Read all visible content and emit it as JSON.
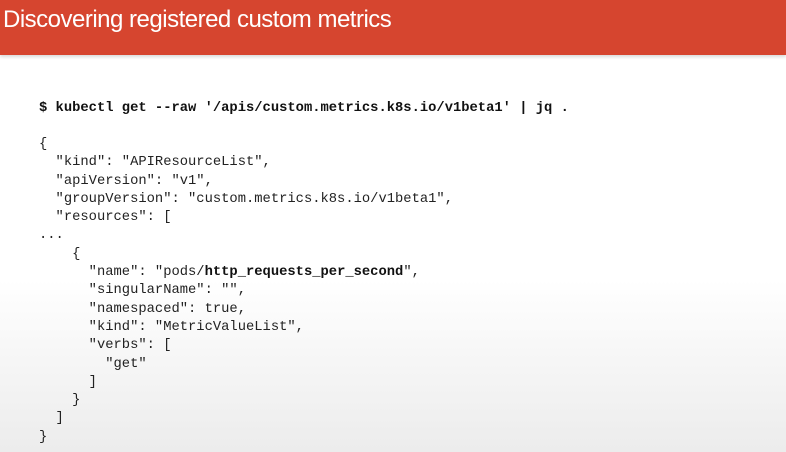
{
  "slide": {
    "title": "Discovering registered custom metrics",
    "command": "$ kubectl get --raw '/apis/custom.metrics.k8s.io/v1beta1' | jq .",
    "colors": {
      "header": "#d6452f",
      "title_text": "#ffffff"
    },
    "output_lines": [
      "{",
      "  \"kind\": \"APIResourceList\",",
      "  \"apiVersion\": \"v1\",",
      "  \"groupVersion\": \"custom.metrics.k8s.io/v1beta1\",",
      "  \"resources\": [",
      "...",
      "    {"
    ],
    "name_line": {
      "prefix": "      \"name\": \"pods/",
      "highlight": "http_requests_per_second",
      "suffix": "\","
    },
    "output_lines_after": [
      "      \"singularName\": \"\",",
      "      \"namespaced\": true,",
      "      \"kind\": \"MetricValueList\",",
      "      \"verbs\": [",
      "        \"get\"",
      "      ]",
      "    }",
      "  ]",
      "}"
    ]
  }
}
